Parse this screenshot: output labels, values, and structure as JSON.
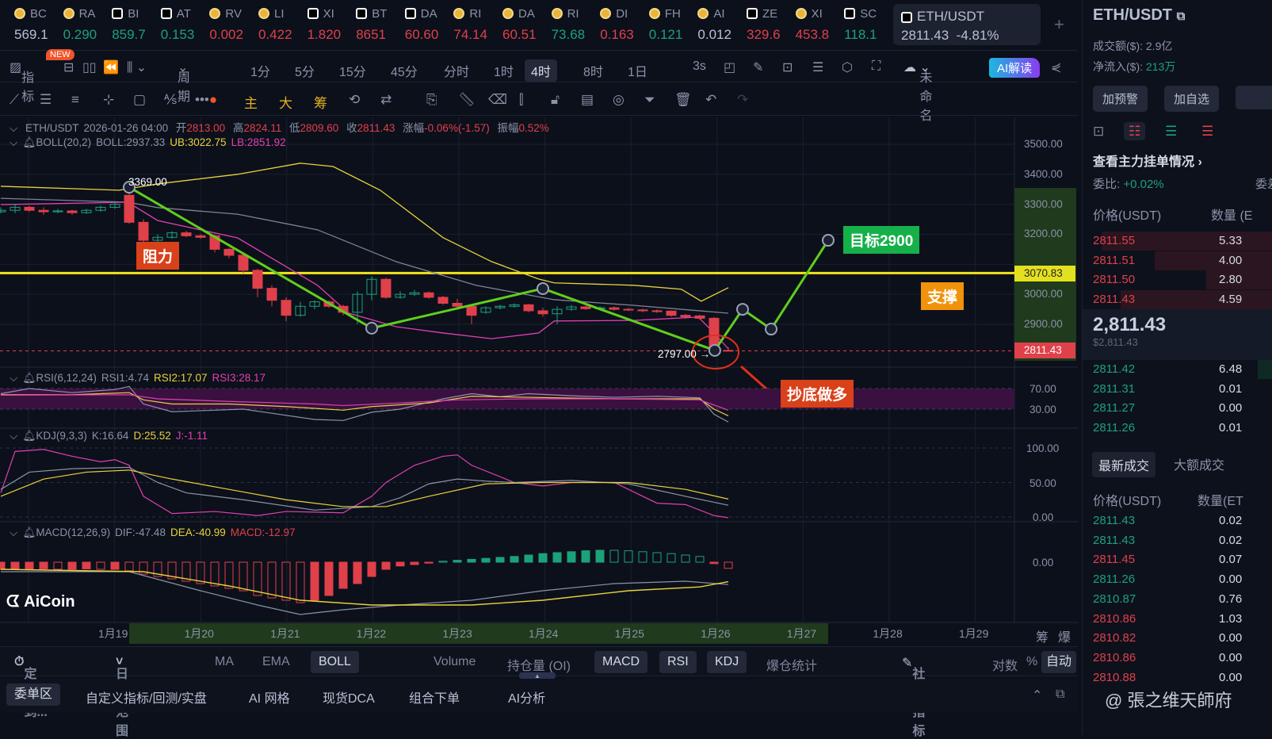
{
  "ticker": [
    {
      "sym": "BC",
      "price": "569.1",
      "c": "w",
      "icon": "coin"
    },
    {
      "sym": "RA",
      "price": "0.290",
      "c": "g",
      "icon": "coin"
    },
    {
      "sym": "BI",
      "price": "859.7",
      "c": "g",
      "icon": "x"
    },
    {
      "sym": "AT",
      "price": "0.153",
      "c": "g",
      "icon": "x"
    },
    {
      "sym": "RV",
      "price": "0.002",
      "c": "r",
      "icon": "coin"
    },
    {
      "sym": "LI",
      "price": "0.422",
      "c": "r",
      "icon": "coin"
    },
    {
      "sym": "XI",
      "price": "1.820",
      "c": "r",
      "icon": "x"
    },
    {
      "sym": "BT",
      "price": "8651",
      "c": "r",
      "icon": "x"
    },
    {
      "sym": "DA",
      "price": "60.60",
      "c": "r",
      "icon": "x"
    },
    {
      "sym": "RI",
      "price": "74.14",
      "c": "r",
      "icon": "coin"
    },
    {
      "sym": "DA",
      "price": "60.51",
      "c": "r",
      "icon": "coin"
    },
    {
      "sym": "RI",
      "price": "73.68",
      "c": "g",
      "icon": "coin"
    },
    {
      "sym": "DI",
      "price": "0.163",
      "c": "r",
      "icon": "coin"
    },
    {
      "sym": "FH",
      "price": "0.121",
      "c": "g",
      "icon": "coin"
    },
    {
      "sym": "AI",
      "price": "0.012",
      "c": "w",
      "icon": "coin"
    },
    {
      "sym": "ZE",
      "price": "329.6",
      "c": "r",
      "icon": "x"
    },
    {
      "sym": "XI",
      "price": "453.8",
      "c": "r",
      "icon": "coin"
    },
    {
      "sym": "SC",
      "price": "118.1",
      "c": "g",
      "icon": "x"
    }
  ],
  "active_pair": {
    "sym": "ETH/USDT",
    "price": "2811.43",
    "change": "-4.81%"
  },
  "toolbar": {
    "indicator": "指标",
    "new_badge": "NEW",
    "period": "周期",
    "timeframes": [
      "1分",
      "5分",
      "15分",
      "45分",
      "分时",
      "1时",
      "4时",
      "8时",
      "1日"
    ],
    "active_tf": "4时",
    "refresh": "3s",
    "layout_name": "未命名",
    "ai": "AI解读"
  },
  "draw_toolbar": {
    "main": "主",
    "big": "大",
    "chips": "筹"
  },
  "legend": {
    "pair": "ETH/USDT",
    "time": "2026-01-26 04:00",
    "open_l": "开",
    "open": "2813.00",
    "high_l": "高",
    "high": "2824.11",
    "low_l": "低",
    "low": "2809.60",
    "close_l": "收",
    "close": "2811.43",
    "chg_l": "涨幅",
    "chg": "-0.06%(-1.57)",
    "amp_l": "振幅",
    "amp": "0.52%",
    "boll": "BOLL(20,2)",
    "boll_mid": "BOLL:2937.33",
    "boll_ub": "UB:3022.75",
    "boll_lb": "LB:2851.92",
    "rsi": "RSI(6,12,24)",
    "rsi1": "RSI1:4.74",
    "rsi2": "RSI2:17.07",
    "rsi3": "RSI3:28.17",
    "kdj": "KDJ(9,3,3)",
    "k": "K:16.64",
    "d": "D:25.52",
    "j": "J:-1.11",
    "macd": "MACD(12,26,9)",
    "dif": "DIF:-47.48",
    "dea": "DEA:-40.99",
    "macd_v": "MACD:-12.97"
  },
  "price_axis": [
    "3500.00",
    "3400.00",
    "3300.00",
    "3200.00",
    "3000.00",
    "2900.00"
  ],
  "price_axis_values": [
    3500,
    3400,
    3300,
    3200,
    3000,
    2900
  ],
  "hline": {
    "label": "3070.83",
    "value": 3070.83
  },
  "last_price": {
    "label": "2811.43",
    "value": 2811.43
  },
  "rsi_axis": [
    "70.00",
    "30.00"
  ],
  "kdj_axis": [
    "100.00",
    "50.00",
    "0.00"
  ],
  "macd_axis": [
    "0.00"
  ],
  "time_axis": [
    "1月19",
    "1月20",
    "1月21",
    "1月22",
    "1月23",
    "1月24",
    "1月25",
    "1月26",
    "1月27",
    "1月28",
    "1月29"
  ],
  "annotations": {
    "high": "3369.00",
    "low": "2797.00",
    "resist": "阻力",
    "support": "支撑",
    "target": "目标2900",
    "buy": "抄底做多",
    "logo": "AiCoin"
  },
  "colors": {
    "up": "#1ba27a",
    "down": "#e0404a",
    "boll_up": "#e8d23a",
    "boll_mid": "#7d8397",
    "boll_lo": "#e040b0",
    "trend": "#5fcf1c"
  },
  "candles": [
    [
      3275,
      3290,
      3270,
      3280
    ],
    [
      3280,
      3300,
      3270,
      3290
    ],
    [
      3290,
      3295,
      3275,
      3280
    ],
    [
      3280,
      3290,
      3265,
      3275
    ],
    [
      3275,
      3285,
      3270,
      3278
    ],
    [
      3278,
      3282,
      3265,
      3272
    ],
    [
      3272,
      3285,
      3268,
      3280
    ],
    [
      3280,
      3295,
      3275,
      3290
    ],
    [
      3290,
      3310,
      3285,
      3300
    ],
    [
      3330,
      3369,
      3235,
      3240
    ],
    [
      3240,
      3250,
      3170,
      3180
    ],
    [
      3180,
      3200,
      3160,
      3190
    ],
    [
      3190,
      3210,
      3185,
      3205
    ],
    [
      3205,
      3212,
      3190,
      3195
    ],
    [
      3195,
      3200,
      3185,
      3190
    ],
    [
      3195,
      3200,
      3140,
      3150
    ],
    [
      3150,
      3155,
      3120,
      3130
    ],
    [
      3130,
      3135,
      3070,
      3080
    ],
    [
      3080,
      3085,
      2990,
      3020
    ],
    [
      3020,
      3030,
      2960,
      2980
    ],
    [
      2980,
      2990,
      2910,
      2930
    ],
    [
      2930,
      2975,
      2925,
      2960
    ],
    [
      2960,
      2980,
      2950,
      2975
    ],
    [
      2975,
      2980,
      2955,
      2960
    ],
    [
      2960,
      2965,
      2930,
      2940
    ],
    [
      2940,
      3010,
      2900,
      3000
    ],
    [
      3000,
      3060,
      2980,
      3050
    ],
    [
      3050,
      3055,
      2985,
      2990
    ],
    [
      2990,
      3010,
      2985,
      3000
    ],
    [
      3000,
      3015,
      2995,
      3005
    ],
    [
      3005,
      3010,
      2985,
      2990
    ],
    [
      2990,
      2995,
      2965,
      2970
    ],
    [
      2970,
      2985,
      2955,
      2960
    ],
    [
      2960,
      2965,
      2900,
      2930
    ],
    [
      2940,
      2960,
      2935,
      2955
    ],
    [
      2955,
      2965,
      2950,
      2960
    ],
    [
      2960,
      2970,
      2955,
      2965
    ],
    [
      2965,
      2968,
      2940,
      2945
    ],
    [
      2945,
      2955,
      2925,
      2935
    ],
    [
      2935,
      2960,
      2900,
      2950
    ],
    [
      2950,
      2965,
      2945,
      2958
    ],
    [
      2958,
      2962,
      2948,
      2952
    ],
    [
      2952,
      2960,
      2950,
      2955
    ],
    [
      2955,
      2960,
      2945,
      2950
    ],
    [
      2950,
      2955,
      2944,
      2948
    ],
    [
      2948,
      2952,
      2940,
      2945
    ],
    [
      2945,
      2950,
      2938,
      2944
    ],
    [
      2944,
      2946,
      2925,
      2930
    ],
    [
      2930,
      2935,
      2918,
      2925
    ],
    [
      2928,
      2932,
      2915,
      2920
    ],
    [
      2920,
      2925,
      2797,
      2825
    ],
    [
      2813,
      2824.11,
      2809.6,
      2811.43
    ]
  ],
  "boll_series": {
    "upper": [
      [
        0,
        3360
      ],
      [
        8.3,
        3347
      ],
      [
        11,
        3368
      ],
      [
        16.6,
        3400
      ],
      [
        21,
        3437
      ],
      [
        23.3,
        3426
      ],
      [
        26.6,
        3347
      ],
      [
        31,
        3189
      ],
      [
        34.4,
        3109
      ],
      [
        37.7,
        3051
      ],
      [
        38.8,
        3038
      ],
      [
        44.4,
        3030
      ],
      [
        47.7,
        3017
      ],
      [
        49.1,
        2977
      ],
      [
        51,
        3022
      ]
    ],
    "mid": [
      [
        0,
        3320
      ],
      [
        8.9,
        3307
      ],
      [
        11,
        3289
      ],
      [
        16.6,
        3267
      ],
      [
        22.2,
        3215
      ],
      [
        27.7,
        3109
      ],
      [
        33.3,
        3030
      ],
      [
        38.8,
        2982
      ],
      [
        44.4,
        2963
      ],
      [
        51,
        2937
      ]
    ],
    "lower": [
      [
        0,
        3299
      ],
      [
        8.9,
        3307
      ],
      [
        11,
        3246
      ],
      [
        16.6,
        3188
      ],
      [
        22.2,
        3030
      ],
      [
        24.4,
        2937
      ],
      [
        27.7,
        2892
      ],
      [
        31,
        2871
      ],
      [
        34.4,
        2852
      ],
      [
        37.7,
        2871
      ],
      [
        38.8,
        2911
      ],
      [
        44.4,
        2913
      ],
      [
        48.9,
        2924
      ],
      [
        50,
        2871
      ],
      [
        51,
        2818
      ]
    ]
  },
  "trend_points": [
    [
      9,
      3357
    ],
    [
      26,
      2887
    ],
    [
      38,
      3019
    ],
    [
      50.05,
      2813
    ],
    [
      52,
      2950
    ],
    [
      54,
      2884
    ],
    [
      58,
      3180
    ]
  ],
  "rsi_series": {
    "rsi1": [
      [
        0,
        60
      ],
      [
        2,
        70
      ],
      [
        5,
        62
      ],
      [
        8,
        68
      ],
      [
        9,
        74
      ],
      [
        10,
        40
      ],
      [
        12,
        25
      ],
      [
        14,
        27
      ],
      [
        17,
        30
      ],
      [
        19,
        22
      ],
      [
        22,
        10
      ],
      [
        24,
        8
      ],
      [
        26,
        24
      ],
      [
        28,
        30
      ],
      [
        31,
        50
      ],
      [
        33,
        60
      ],
      [
        35,
        54
      ],
      [
        37,
        60
      ],
      [
        40,
        56
      ],
      [
        43,
        53
      ],
      [
        46,
        55
      ],
      [
        49,
        52
      ],
      [
        50,
        20
      ],
      [
        51,
        5
      ]
    ],
    "rsi2": [
      [
        0,
        58
      ],
      [
        5,
        58
      ],
      [
        9,
        62
      ],
      [
        10,
        48
      ],
      [
        12,
        40
      ],
      [
        16,
        40
      ],
      [
        20,
        35
      ],
      [
        24,
        28
      ],
      [
        26,
        35
      ],
      [
        30,
        42
      ],
      [
        33,
        55
      ],
      [
        37,
        53
      ],
      [
        43,
        50
      ],
      [
        49,
        50
      ],
      [
        50,
        30
      ],
      [
        51,
        17
      ]
    ],
    "rsi3": [
      [
        0,
        57
      ],
      [
        9,
        58
      ],
      [
        11,
        50
      ],
      [
        16,
        45
      ],
      [
        22,
        40
      ],
      [
        24,
        37
      ],
      [
        28,
        42
      ],
      [
        32,
        48
      ],
      [
        37,
        50
      ],
      [
        43,
        50
      ],
      [
        49,
        48
      ],
      [
        51,
        28
      ]
    ]
  },
  "kdj_series": {
    "j": [
      [
        0,
        35
      ],
      [
        1,
        95
      ],
      [
        3,
        98
      ],
      [
        5,
        88
      ],
      [
        7,
        80
      ],
      [
        8,
        83
      ],
      [
        9,
        75
      ],
      [
        10,
        30
      ],
      [
        12,
        5
      ],
      [
        15,
        8
      ],
      [
        18,
        2
      ],
      [
        20,
        8
      ],
      [
        24,
        6
      ],
      [
        26,
        30
      ],
      [
        27,
        50
      ],
      [
        29,
        75
      ],
      [
        31,
        88
      ],
      [
        32,
        90
      ],
      [
        33,
        75
      ],
      [
        36,
        50
      ],
      [
        38,
        45
      ],
      [
        40,
        50
      ],
      [
        43,
        50
      ],
      [
        46,
        20
      ],
      [
        48,
        18
      ],
      [
        50,
        2
      ],
      [
        51,
        -1
      ]
    ],
    "k": [
      [
        0,
        40
      ],
      [
        2,
        65
      ],
      [
        5,
        70
      ],
      [
        9,
        72
      ],
      [
        11,
        50
      ],
      [
        13,
        35
      ],
      [
        17,
        25
      ],
      [
        22,
        10
      ],
      [
        26,
        15
      ],
      [
        28,
        28
      ],
      [
        30,
        48
      ],
      [
        32,
        55
      ],
      [
        34,
        52
      ],
      [
        36,
        50
      ],
      [
        40,
        53
      ],
      [
        44,
        48
      ],
      [
        48,
        30
      ],
      [
        51,
        17
      ]
    ],
    "d": [
      [
        0,
        30
      ],
      [
        3,
        55
      ],
      [
        6,
        65
      ],
      [
        9,
        68
      ],
      [
        12,
        55
      ],
      [
        16,
        40
      ],
      [
        20,
        25
      ],
      [
        24,
        15
      ],
      [
        27,
        15
      ],
      [
        30,
        30
      ],
      [
        34,
        48
      ],
      [
        38,
        50
      ],
      [
        44,
        50
      ],
      [
        48,
        40
      ],
      [
        51,
        26
      ]
    ]
  },
  "macd_series": {
    "hist": [
      -15,
      -15,
      -15,
      -14,
      -15,
      -15,
      -14,
      -15,
      -15,
      -18,
      -25,
      -30,
      -35,
      -40,
      -45,
      -50,
      -55,
      -60,
      -70,
      -75,
      -80,
      -85,
      -80,
      -70,
      -55,
      -45,
      -30,
      -15,
      -8,
      -5,
      -2,
      2,
      4,
      6,
      8,
      10,
      12,
      15,
      18,
      20,
      22,
      24,
      25,
      25,
      24,
      22,
      20,
      18,
      15,
      12,
      -3,
      -13
    ],
    "dif": [
      [
        0,
        -20
      ],
      [
        9,
        -20
      ],
      [
        14,
        -60
      ],
      [
        18,
        -90
      ],
      [
        21,
        -110
      ],
      [
        24,
        -100
      ],
      [
        28,
        -90
      ],
      [
        33,
        -80
      ],
      [
        38,
        -60
      ],
      [
        43,
        -45
      ],
      [
        48,
        -40
      ],
      [
        51,
        -47
      ]
    ],
    "dea": [
      [
        0,
        -15
      ],
      [
        10,
        -20
      ],
      [
        16,
        -50
      ],
      [
        21,
        -80
      ],
      [
        26,
        -90
      ],
      [
        33,
        -90
      ],
      [
        38,
        -80
      ],
      [
        44,
        -60
      ],
      [
        49,
        -52
      ],
      [
        51,
        -41
      ]
    ]
  },
  "indicator_bar": {
    "locate": "定位到...",
    "range": "日期范围",
    "items": [
      "MA",
      "EMA",
      "BOLL",
      "Volume",
      "持仓量 (OI)",
      "MACD",
      "RSI",
      "KDJ",
      "爆仓统计"
    ],
    "community": "社区指标",
    "log": "对数",
    "pct": "%",
    "auto": "自动",
    "chips": "筹",
    "liq": "爆"
  },
  "bottom_tabs": [
    "委单区",
    "自定义指标/回测/实盘",
    "AI 网格",
    "现货DCA",
    "组合下单",
    "AI分析"
  ],
  "right": {
    "title": "ETH/USDT",
    "volume_l": "成交额($):",
    "volume": "2.9亿",
    "netflow_l": "净流入($):",
    "netflow": "213万",
    "btn_alert": "加预警",
    "btn_watch": "加自选",
    "depth_link": "查看主力挂单情况",
    "ratio_l": "委比:",
    "ratio": "+0.02%",
    "ratio2_l": "委差",
    "price_h": "价格(USDT)",
    "qty_h": "数量 (E",
    "asks": [
      {
        "p": "2811.55",
        "q": "5.33",
        "w": 0.9
      },
      {
        "p": "2811.51",
        "q": "4.00",
        "w": 0.62
      },
      {
        "p": "2811.50",
        "q": "2.80",
        "w": 0.35
      },
      {
        "p": "2811.43",
        "q": "4.59",
        "w": 0.8
      }
    ],
    "mid_price": "2,811.43",
    "mid_usd": "$2,811.43",
    "bids": [
      {
        "p": "2811.42",
        "q": "6.48",
        "w": 0.08
      },
      {
        "p": "2811.31",
        "q": "0.01"
      },
      {
        "p": "2811.27",
        "q": "0.00"
      },
      {
        "p": "2811.26",
        "q": "0.01"
      }
    ],
    "tab_latest": "最新成交",
    "tab_large": "大额成交",
    "trade_price_h": "价格(USDT)",
    "trade_qty_h": "数量(ET",
    "trades": [
      {
        "p": "2811.43",
        "q": "0.02",
        "c": "g"
      },
      {
        "p": "2811.43",
        "q": "0.02",
        "c": "g"
      },
      {
        "p": "2811.45",
        "q": "0.07",
        "c": "r"
      },
      {
        "p": "2811.26",
        "q": "0.00",
        "c": "g"
      },
      {
        "p": "2810.87",
        "q": "0.76",
        "c": "g"
      },
      {
        "p": "2810.86",
        "q": "1.03",
        "c": "r"
      },
      {
        "p": "2810.82",
        "q": "0.00",
        "c": "r"
      },
      {
        "p": "2810.86",
        "q": "0.00",
        "c": "r"
      },
      {
        "p": "2810.88",
        "q": "0.00",
        "c": "r"
      }
    ],
    "watermark": "@ 張之维天師府"
  }
}
